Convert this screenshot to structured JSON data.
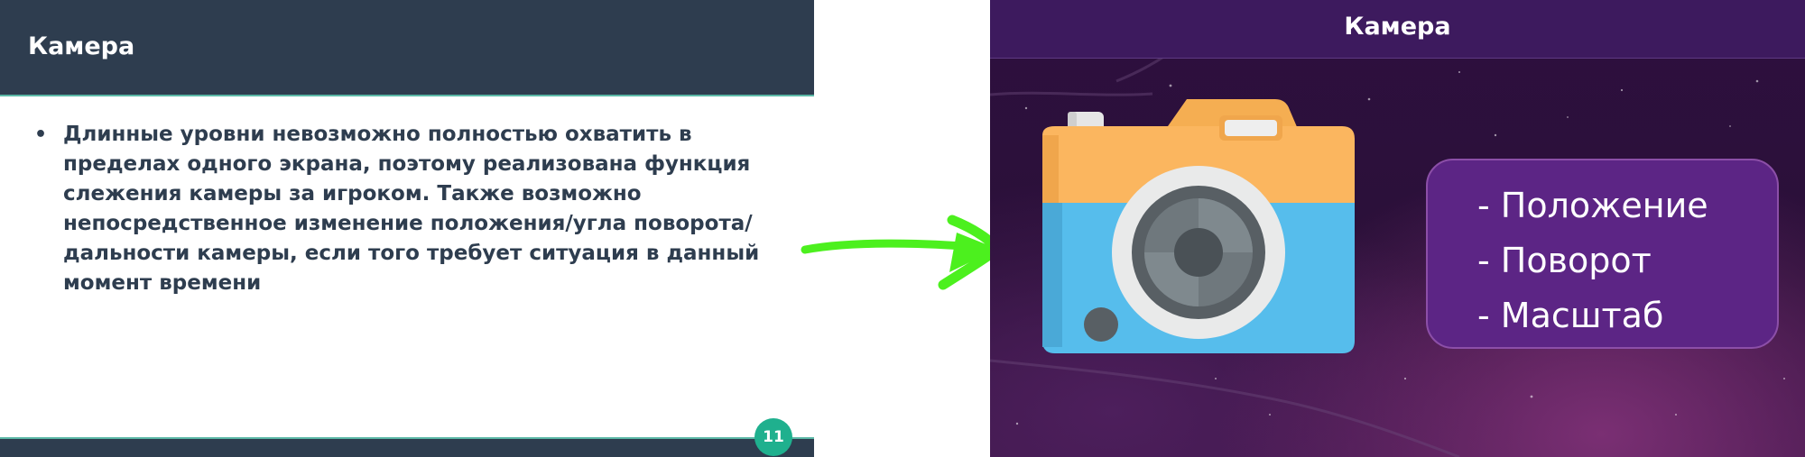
{
  "left_slide": {
    "title": "Камера",
    "bullets": [
      "Длинные уровни невозможно полностью охватить в пределах одного экрана, поэтому реализована функция слежения камеры за игроком. Также возможно непосредственное изменение положения/угла поворота/дальности камеры, если того требует ситуация в данный момент времени"
    ],
    "bullet_marker": "•",
    "page_number": "11"
  },
  "right_slide": {
    "title": "Камера",
    "properties": [
      "- Положение",
      "- Поворот",
      "- Масштаб"
    ]
  },
  "icons": {
    "arrow": "arrow-right-icon",
    "camera": "camera-icon"
  },
  "colors": {
    "header_dark": "#2e3d4f",
    "accent_teal": "#1fb08e",
    "arrow_green": "#4cf01e",
    "purple_box": "#5c2585"
  }
}
